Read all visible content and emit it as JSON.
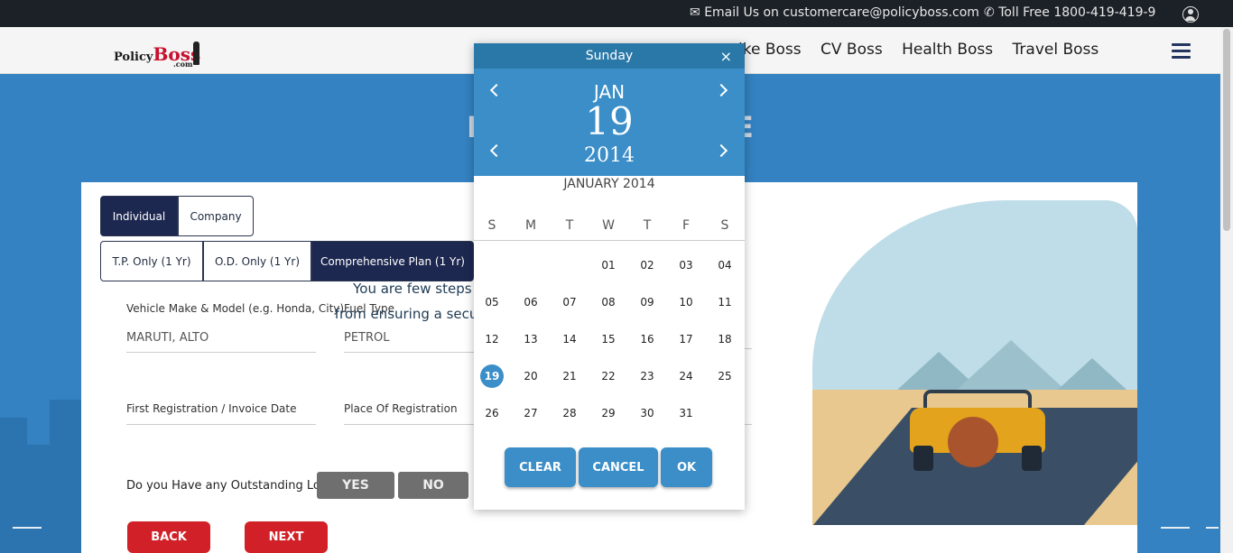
{
  "topbar": {
    "email_text": "Email Us on customercare@policyboss.com",
    "toll_text": "Toll Free 1800-419-419-9"
  },
  "header": {
    "logo_part1": "Policy",
    "logo_part2": "Boss",
    "logo_com": ".com",
    "nav": [
      "ike Boss",
      "CV Boss",
      "Health Boss",
      "Travel Boss"
    ]
  },
  "hero": {
    "title_left": "I",
    "title_right": "E"
  },
  "form": {
    "owner_types": [
      "Individual",
      "Company"
    ],
    "plans": [
      "T.P. Only (1 Yr)",
      "O.D. Only (1 Yr)",
      "Comprehensive Plan (1 Yr)"
    ],
    "vehicle_label": "Vehicle Make & Model (e.g. Honda, City)",
    "vehicle_value": "MARUTI, ALTO",
    "fuel_label": "Fuel Type",
    "fuel_value": "PETROL",
    "reg_date_label": "First Registration / Invoice Date",
    "place_label": "Place Of Registration",
    "loan_question": "Do you Have any Outstanding Loan?",
    "yes": "YES",
    "no": "NO",
    "back": "BACK",
    "next": "NEXT"
  },
  "illustration": {
    "line1": "You are few steps away",
    "line2": "from ensuring a secure drive"
  },
  "datepicker": {
    "weekday": "Sunday",
    "close": "×",
    "month": "JAN",
    "day": "19",
    "year": "2014",
    "caption": "JANUARY 2014",
    "dow": [
      "S",
      "M",
      "T",
      "W",
      "T",
      "F",
      "S"
    ],
    "first_weekday_index": 3,
    "days_in_month": 31,
    "selected_day": 19,
    "clear": "CLEAR",
    "cancel": "CANCEL",
    "ok": "OK",
    "accent": "#3b8ec8"
  }
}
